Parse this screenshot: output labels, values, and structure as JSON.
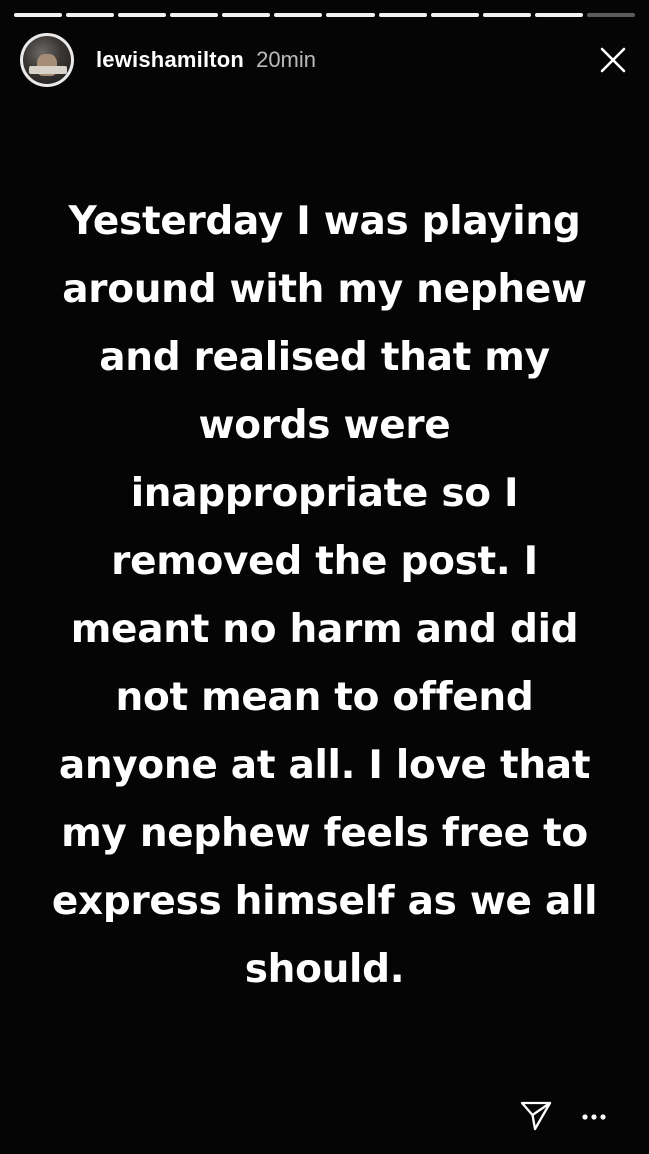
{
  "story": {
    "progress_segments": [
      1,
      1,
      1,
      1,
      1,
      1,
      1,
      1,
      1,
      1,
      1,
      0
    ],
    "account": {
      "username": "lewishamilton",
      "timestamp": "20min",
      "avatar_icon": "profile-photo"
    },
    "lines": [
      "Yesterday I was playing",
      "around with my nephew",
      "and realised that my",
      "words were",
      "inappropriate so I",
      "removed the post. I",
      "meant no harm and did",
      "not mean to offend",
      "anyone at all. I love that",
      "my nephew feels free to",
      "express himself as we all",
      "should."
    ],
    "actions": {
      "close_icon": "close-icon",
      "send_icon": "direct-send-icon",
      "more_icon": "more-options-icon"
    }
  },
  "colors": {
    "background": "#050505",
    "text": "#ffffff",
    "progress_filled": "#ffffff",
    "progress_track": "#7a7a7a"
  }
}
